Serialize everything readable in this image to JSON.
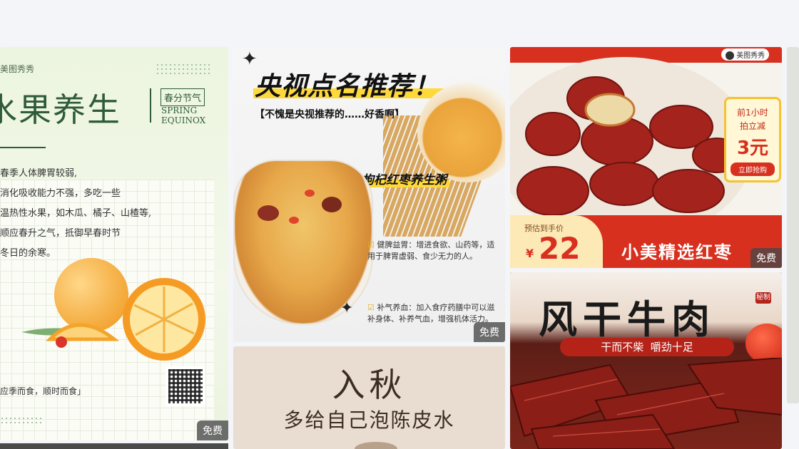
{
  "cards": [
    {
      "brand": "美图秀秀",
      "title": "水果养生",
      "tag": "春分节气",
      "en1": "SPRING",
      "en2": "EQUINOX",
      "lines": [
        "春季人体脾胃较弱,",
        "消化吸收能力不强，多吃一些",
        "温热性水果，如木瓜、橘子、山楂等,",
        "顺应春升之气，抵御早春时节",
        "冬日的余寒。"
      ],
      "footer": "应季而食，顺时而食」",
      "badge": "免费"
    },
    {
      "title": "央视点名推荐！",
      "subtitle": "【不愧是央视推荐的……好香啊】",
      "dish": "枸杞红枣养生粥",
      "point1": "健脾益胃：增进食欲、山药等，适用于脾胃虚弱、食少无力的人。",
      "point2": "补气养血：加入食疗药膳中可以滋补身体、补养气血，增强机体活力。",
      "badge": "免费"
    },
    {
      "title": "入秋",
      "subtitle": "多给自己泡陈皮水"
    },
    {
      "brand": "美图秀秀",
      "promo1": "前1小时",
      "promo2": "拍立减",
      "promo_price": "3元",
      "promo_btn": "立即抢购",
      "est_label": "预估到手价",
      "currency": "¥",
      "price": "22",
      "product": "小美精选红枣",
      "badge": "免费"
    },
    {
      "title": "风干牛肉",
      "stamp": "秘制",
      "slogan": "干而不柴  嚼劲十足"
    }
  ]
}
